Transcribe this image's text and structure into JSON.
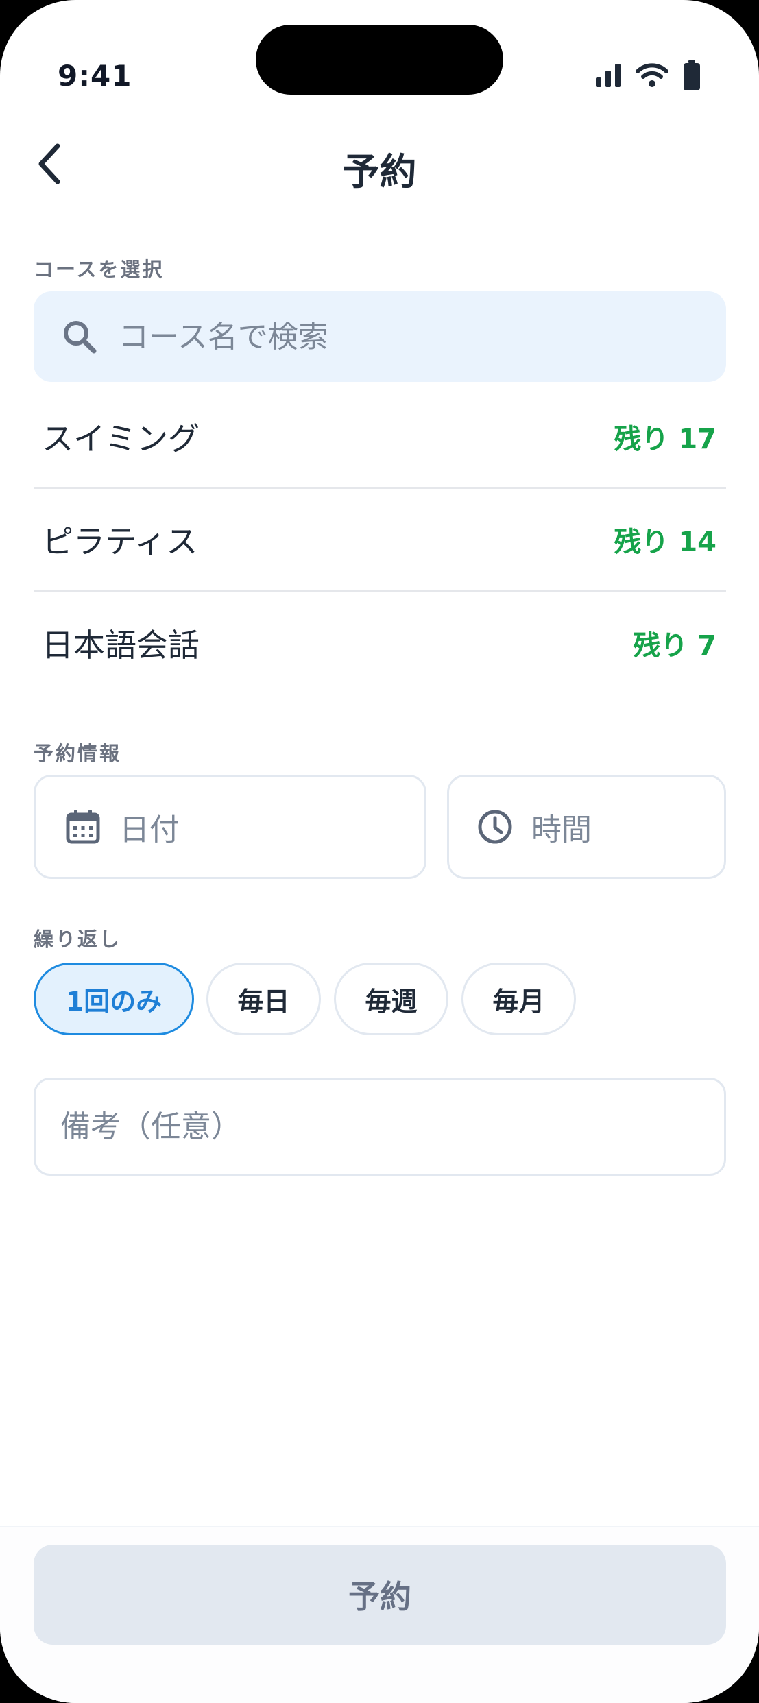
{
  "status_bar": {
    "time": "9:41"
  },
  "header": {
    "title": "予約",
    "back_icon": "chevron-left-icon"
  },
  "course_section": {
    "label": "コースを選択",
    "search": {
      "placeholder": "コース名で検索",
      "value": ""
    },
    "courses": [
      {
        "name": "スイミング",
        "remaining": "残り 17"
      },
      {
        "name": "ピラティス",
        "remaining": "残り 14"
      },
      {
        "name": "日本語会話",
        "remaining": "残り 7"
      }
    ]
  },
  "reservation_info": {
    "label": "予約情報",
    "date_label": "日付",
    "time_label": "時間"
  },
  "repeat": {
    "label": "繰り返し",
    "options": [
      "1回のみ",
      "毎日",
      "毎週",
      "毎月"
    ],
    "selected": "1回のみ"
  },
  "notes": {
    "placeholder": "備考（任意）",
    "value": ""
  },
  "footer": {
    "reserve_label": "予約"
  },
  "colors": {
    "accent": "#1e7fd6",
    "available": "#16a34a",
    "text_primary": "#1f2937",
    "muted": "#7c8797",
    "search_bg": "#eaf3fd",
    "disabled_button": "#e2e8f0"
  }
}
